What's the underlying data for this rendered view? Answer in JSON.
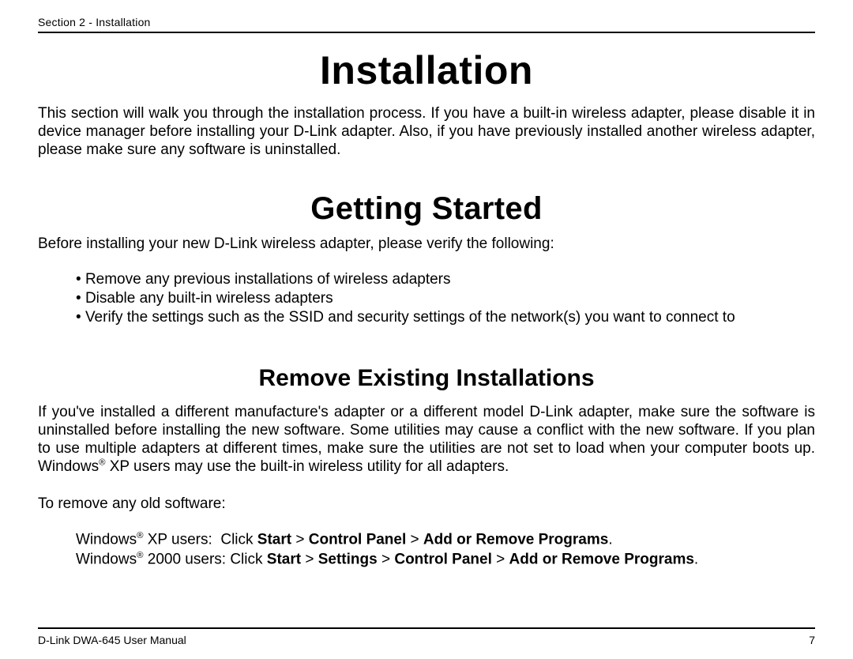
{
  "header": {
    "section_label": "Section 2 - Installation"
  },
  "main": {
    "title": "Installation",
    "intro": "This section will walk you through the installation process. If you have a built-in wireless adapter, please disable it in device manager before installing your D-Link adapter. Also, if you have previously installed another wireless adapter, please make sure any software is uninstalled.",
    "getting_started": {
      "title": "Getting Started",
      "lead": "Before installing your new D-Link wireless adapter, please verify the following:",
      "bullets": [
        "Remove any previous installations of wireless adapters",
        "Disable any built-in wireless adapters",
        "Verify the settings such as the SSID and security settings of the network(s) you want to connect to"
      ]
    },
    "remove_existing": {
      "title": "Remove Existing Installations",
      "para_pre": "If you've installed a different manufacture's adapter or a different model D-Link adapter, make sure the software is uninstalled before installing the new software. Some utilities may cause a conflict with the new software. If you plan to use multiple adapters at different times, make sure the utilities are not set to load when your computer boots up. Windows",
      "reg": "®",
      "para_post": " XP users may use the built-in wireless utility for all adapters.",
      "to_remove": "To remove any old software:",
      "xp": {
        "prefix": "Windows",
        "sup": "®",
        "body": " XP users:  Click ",
        "b1": "Start",
        "gt1": " > ",
        "b2": "Control Panel",
        "gt2": " > ",
        "b3": "Add or Remove Programs",
        "dot": ". "
      },
      "w2k": {
        "prefix": "Windows",
        "sup": "®",
        "body": " 2000 users: Click ",
        "b1": "Start",
        "gt1": " > ",
        "b2": "Settings",
        "gt2": " > ",
        "b3": "Control Panel",
        "gt3": " > ",
        "b4": "Add or Remove Programs",
        "dot": ". "
      }
    }
  },
  "footer": {
    "manual": "D-Link DWA-645 User Manual",
    "page": "7"
  }
}
